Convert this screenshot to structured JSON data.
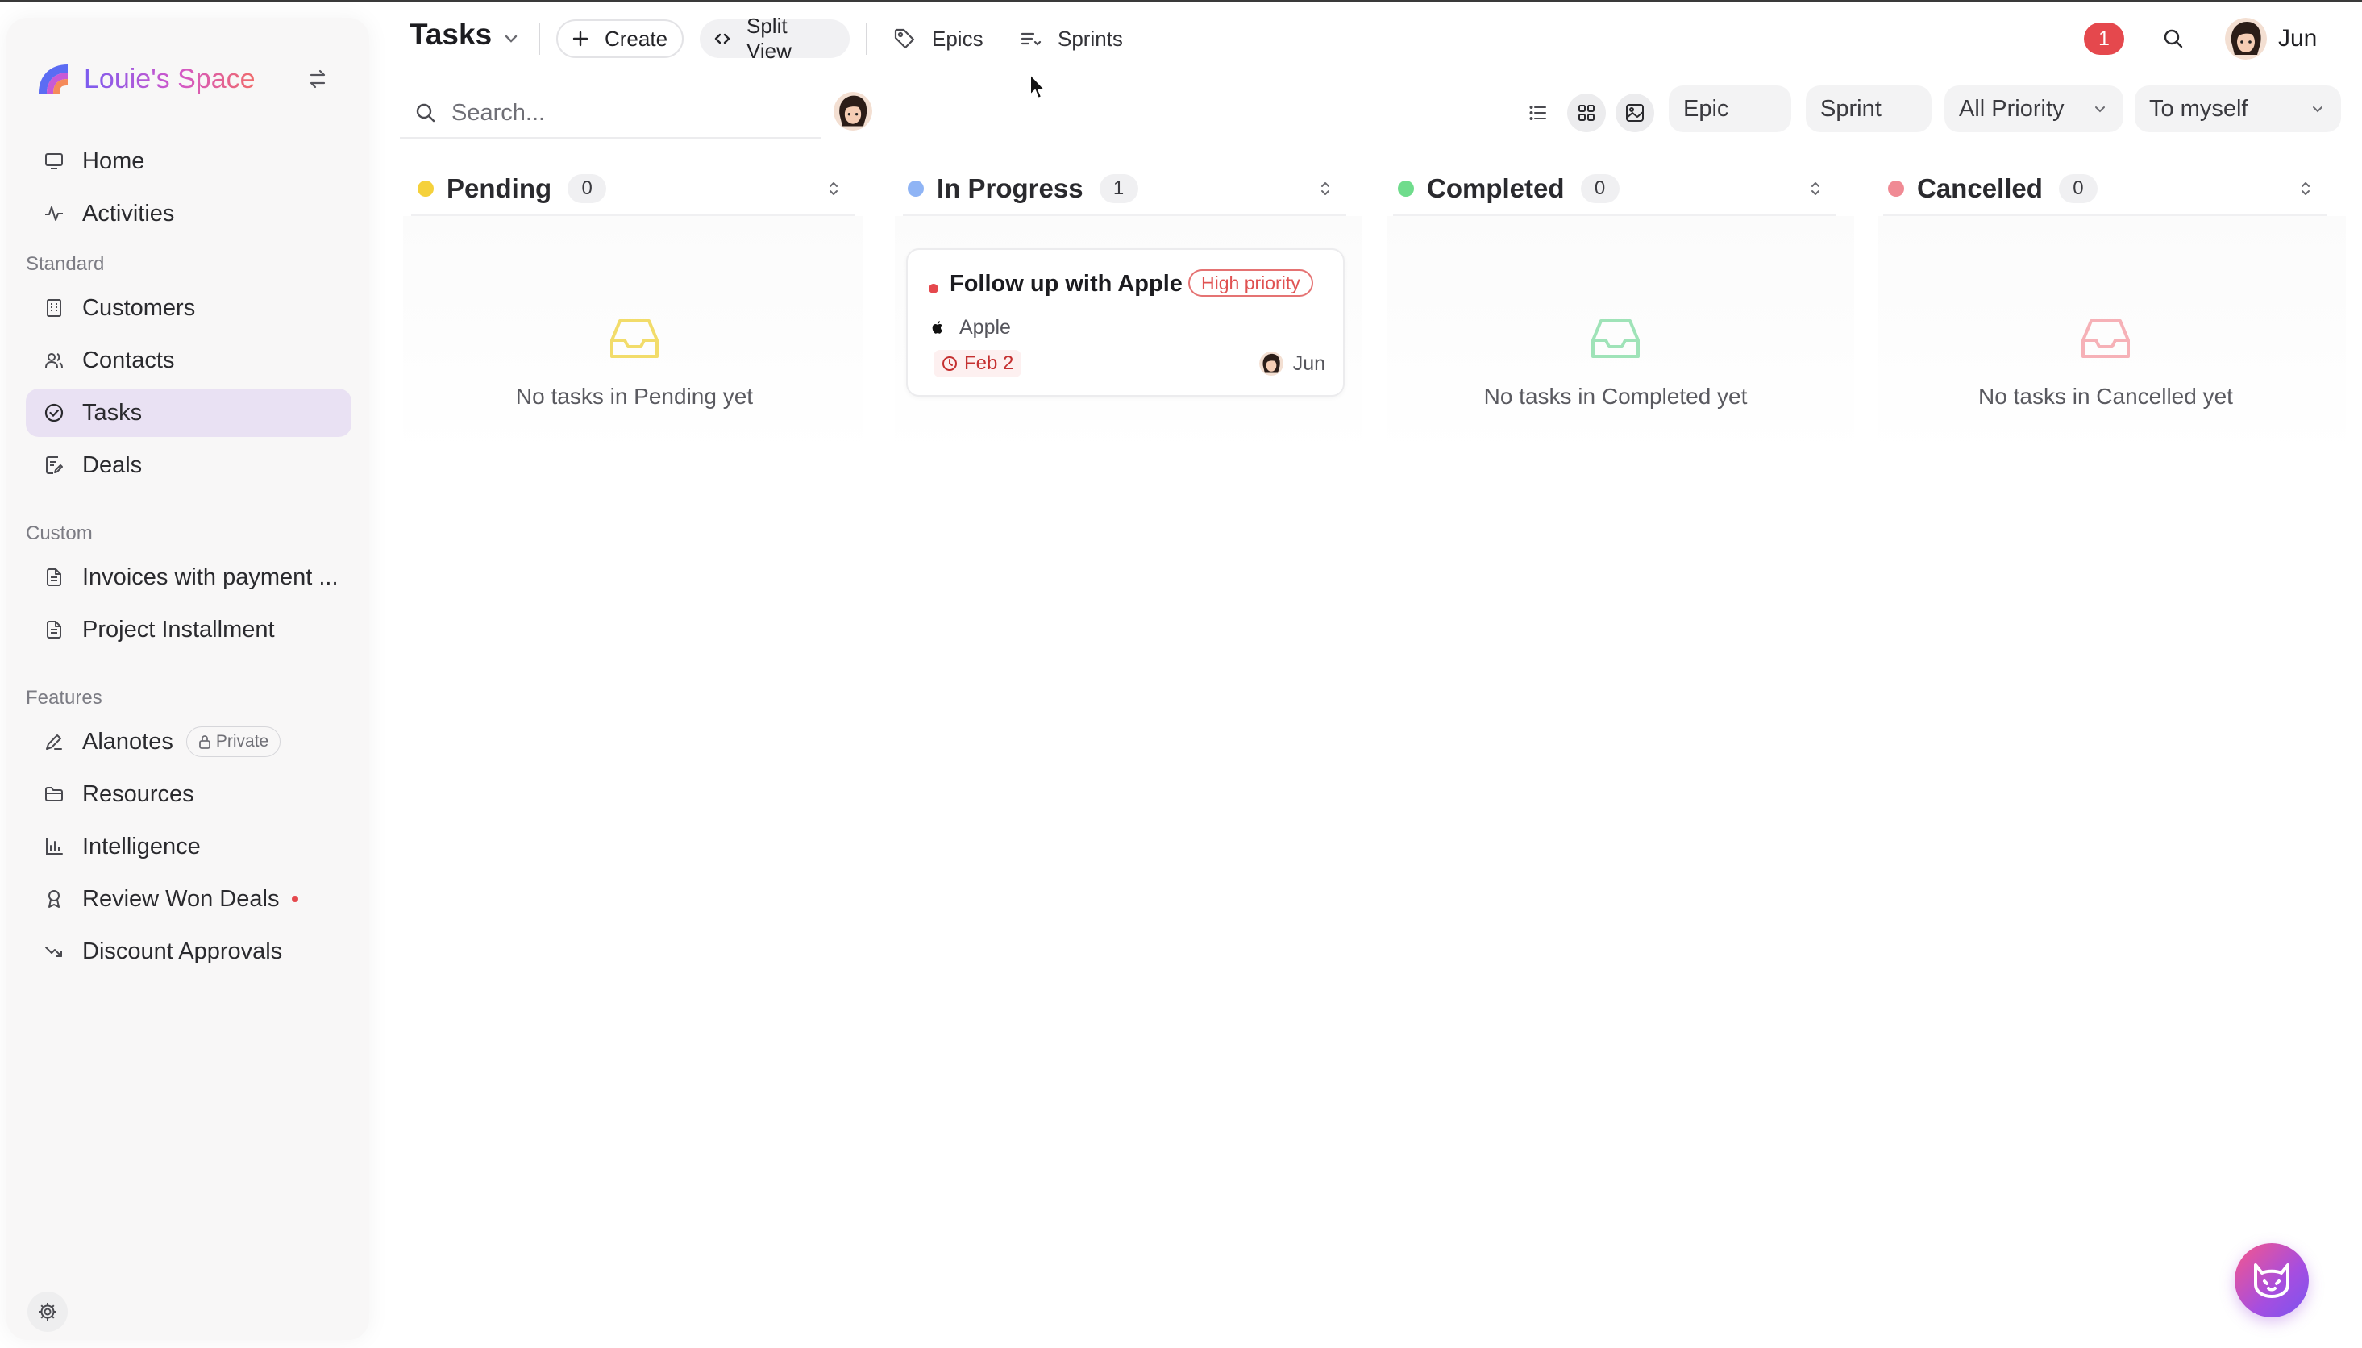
{
  "workspace": {
    "name": "Louie's Space"
  },
  "sidebar": {
    "top_items": [
      {
        "label": "Home",
        "icon": "monitor-icon"
      },
      {
        "label": "Activities",
        "icon": "activity-icon"
      }
    ],
    "sections": {
      "standard": "Standard",
      "custom": "Custom",
      "features": "Features"
    },
    "standard_items": [
      {
        "label": "Customers",
        "icon": "building-icon"
      },
      {
        "label": "Contacts",
        "icon": "users-icon"
      },
      {
        "label": "Tasks",
        "icon": "check-circle-icon",
        "active": true
      },
      {
        "label": "Deals",
        "icon": "file-edit-icon"
      }
    ],
    "custom_items": [
      {
        "label": "Invoices with payment ...",
        "icon": "document-icon"
      },
      {
        "label": "Project Installment",
        "icon": "document-icon"
      }
    ],
    "feature_items": [
      {
        "label": "Alanotes",
        "icon": "pen-icon",
        "badge": "Private"
      },
      {
        "label": "Resources",
        "icon": "folder-icon"
      },
      {
        "label": "Intelligence",
        "icon": "bar-chart-icon"
      },
      {
        "label": "Review Won Deals",
        "icon": "award-icon",
        "dot": true
      },
      {
        "label": "Discount Approvals",
        "icon": "trend-down-icon"
      }
    ]
  },
  "header": {
    "title": "Tasks",
    "create_label": "Create",
    "split_view_label": "Split View",
    "epics_label": "Epics",
    "sprints_label": "Sprints",
    "notification_count": "1",
    "user_name": "Jun"
  },
  "toolbar": {
    "search_placeholder": "Search...",
    "epic_label": "Epic",
    "sprint_label": "Sprint",
    "priority_label": "All Priority",
    "assign_label": "To myself"
  },
  "columns": [
    {
      "name": "Pending",
      "count": "0",
      "color": "#f5d13b",
      "empty_text": "No tasks in Pending yet",
      "empty_color": "#f2dc6a"
    },
    {
      "name": "In Progress",
      "count": "1",
      "color": "#8fb4f5"
    },
    {
      "name": "Completed",
      "count": "0",
      "color": "#6fdc8c",
      "empty_text": "No tasks in Completed yet",
      "empty_color": "#9fe3b8"
    },
    {
      "name": "Cancelled",
      "count": "0",
      "color": "#f08a94",
      "empty_text": "No tasks in Cancelled yet",
      "empty_color": "#f6b1b7"
    }
  ],
  "task_card": {
    "title": "Follow up with Apple",
    "priority": "High priority",
    "company": "Apple",
    "due": "Feb 2",
    "assignee": "Jun"
  },
  "colors": {
    "accent": "#e9e1f3",
    "danger": "#e5484d"
  }
}
